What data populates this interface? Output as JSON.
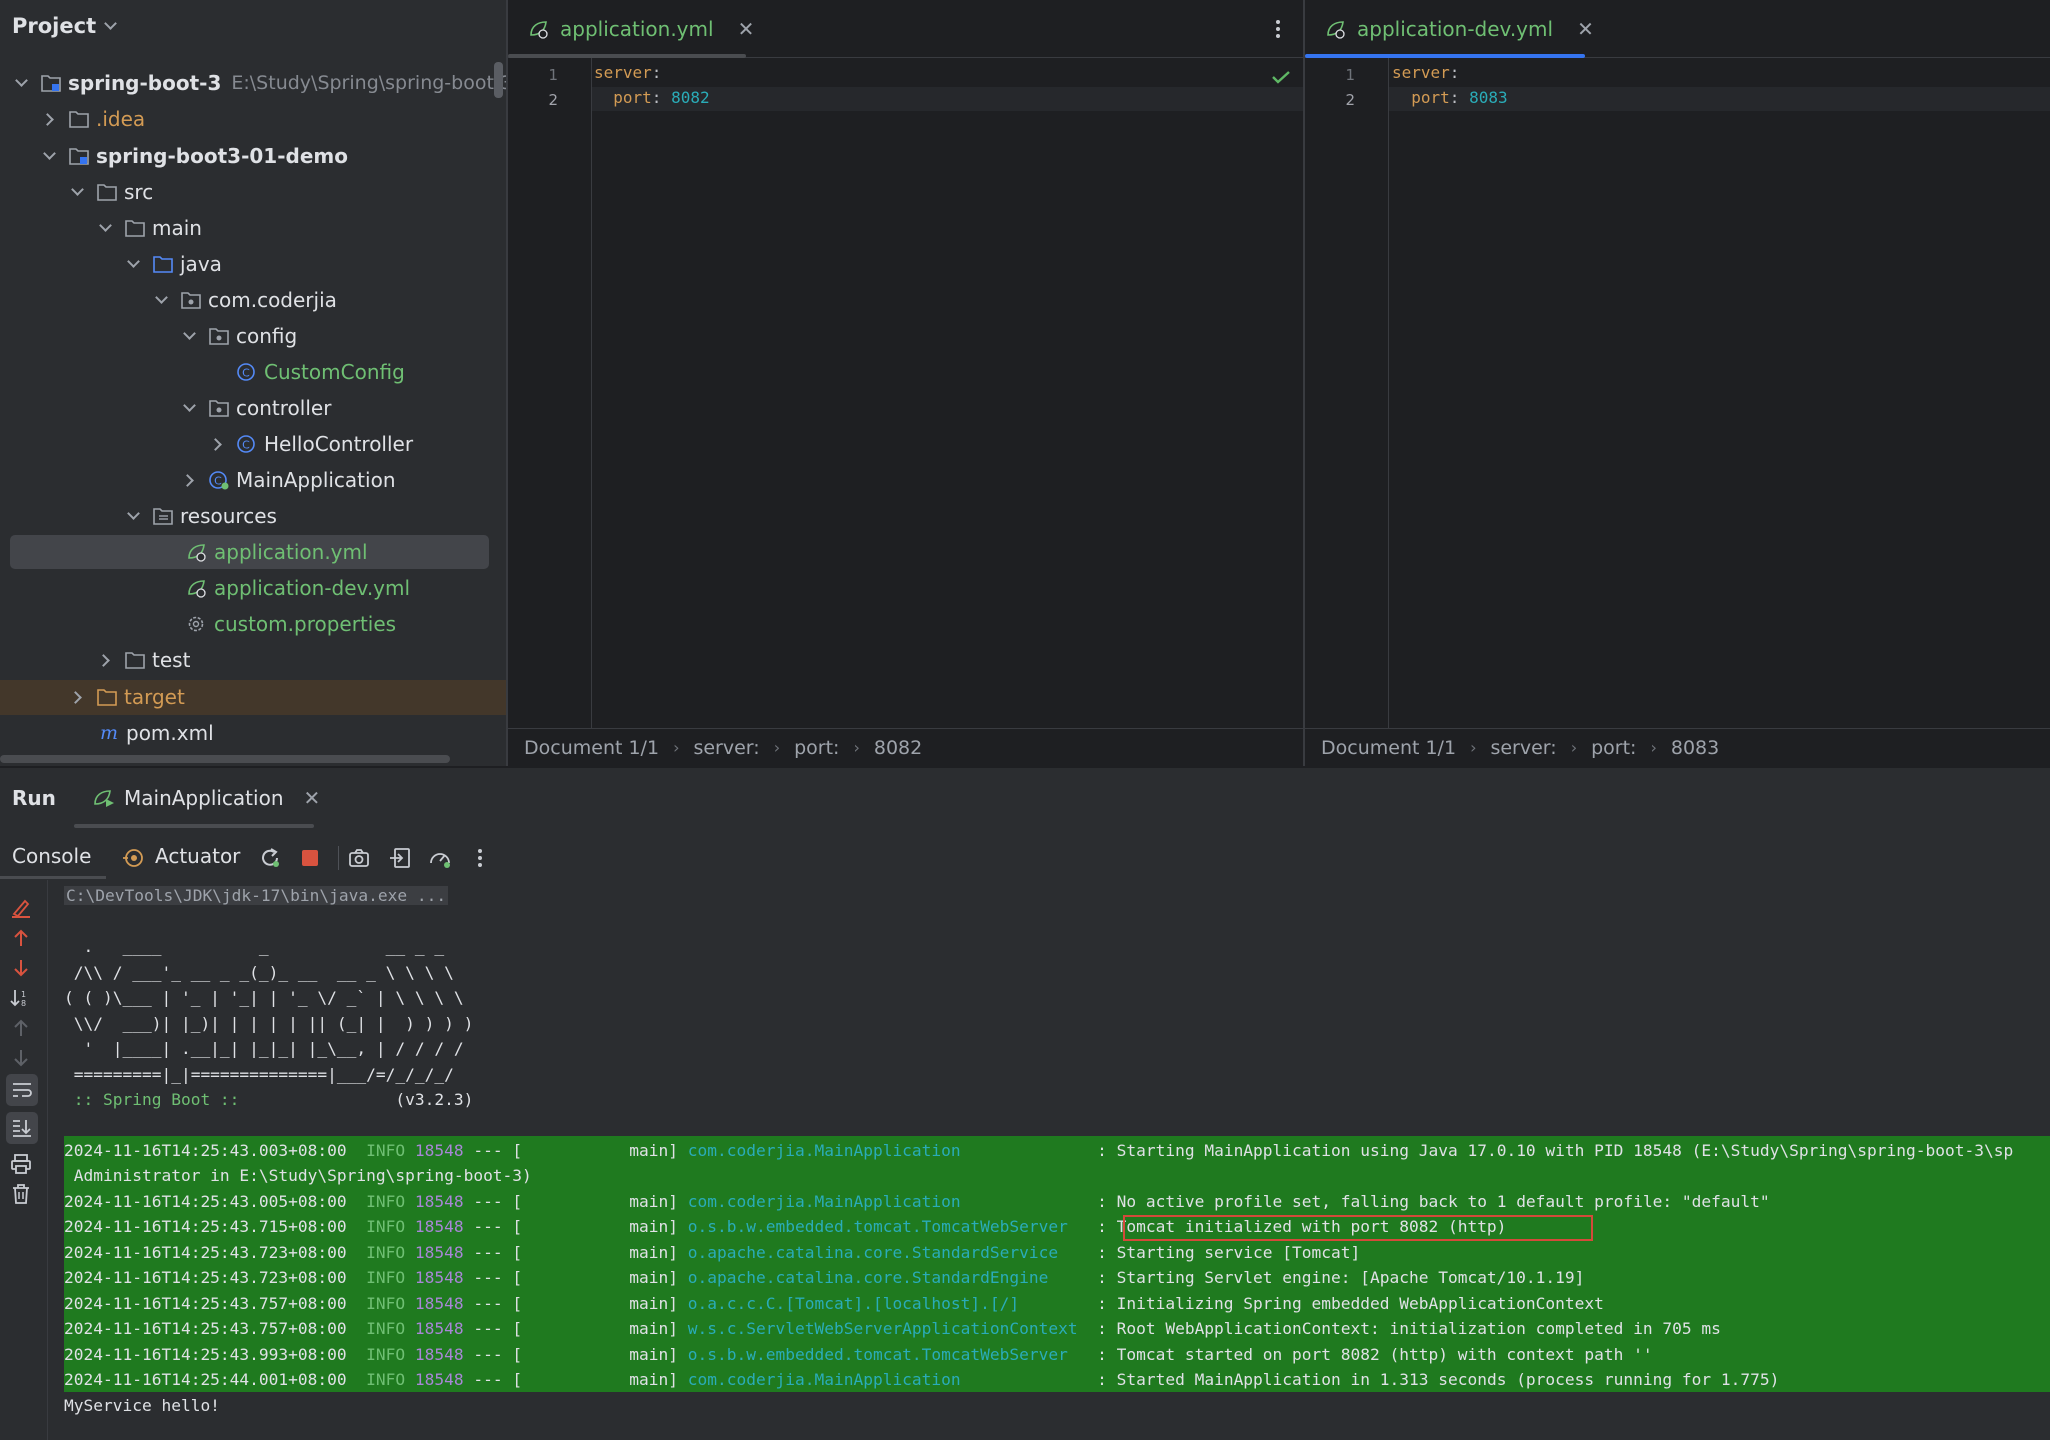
{
  "project": {
    "header": "Project",
    "tree": [
      {
        "label": "spring-boot-3",
        "path": "E:\\Study\\Spring\\spring-boot-3"
      },
      {
        "label": ".idea"
      },
      {
        "label": "spring-boot3-01-demo"
      },
      {
        "label": "src"
      },
      {
        "label": "main"
      },
      {
        "label": "java"
      },
      {
        "label": "com.coderjia"
      },
      {
        "label": "config"
      },
      {
        "label": "CustomConfig"
      },
      {
        "label": "controller"
      },
      {
        "label": "HelloController"
      },
      {
        "label": "MainApplication"
      },
      {
        "label": "resources"
      },
      {
        "label": "application.yml"
      },
      {
        "label": "application-dev.yml"
      },
      {
        "label": "custom.properties"
      },
      {
        "label": "test"
      },
      {
        "label": "target"
      },
      {
        "label": "pom.xml"
      }
    ]
  },
  "editors": [
    {
      "tab": "application.yml",
      "lines": [
        {
          "num": "1",
          "key": "server",
          "punc": ":"
        },
        {
          "num": "2",
          "key": "  port",
          "punc": ": ",
          "value": "8082"
        }
      ],
      "breadcrumb": [
        "Document 1/1",
        "server:",
        "port:",
        "8082"
      ]
    },
    {
      "tab": "application-dev.yml",
      "lines": [
        {
          "num": "1",
          "key": "server",
          "punc": ":"
        },
        {
          "num": "2",
          "key": "  port",
          "punc": ": ",
          "value": "8083"
        }
      ],
      "breadcrumb": [
        "Document 1/1",
        "server:",
        "port:",
        "8083"
      ]
    }
  ],
  "run": {
    "title": "Run",
    "tab": "MainApplication",
    "toolbar": {
      "console": "Console",
      "actuator": "Actuator"
    },
    "command": "C:\\DevTools\\JDK\\jdk-17\\bin\\java.exe ...",
    "banner": [
      "  .   ____          _            __ _ _",
      " /\\\\ / ___'_ __ _ _(_)_ __  __ _ \\ \\ \\ \\",
      "( ( )\\___ | '_ | '_| | '_ \\/ _` | \\ \\ \\ \\",
      " \\\\/  ___)| |_)| | | | | || (_| |  ) ) ) )",
      "  '  |____| .__|_| |_|_| |_\\__, | / / / /",
      " =========|_|==============|___/=/_/_/_/"
    ],
    "spring_tag": " :: Spring Boot ::",
    "spring_version": "(v3.2.3)",
    "logs": [
      {
        "ts": "2024-11-16T14:25:43.003+08:00",
        "level": "INFO",
        "pid": "18548",
        "thread": "--- [           main]",
        "logger": "com.coderjia.MainApplication           ",
        "msg": ": Starting MainApplication using Java 17.0.10 with PID 18548 (E:\\Study\\Spring\\spring-boot-3\\sp"
      },
      {
        "cont": " Administrator in E:\\Study\\Spring\\spring-boot-3)"
      },
      {
        "ts": "2024-11-16T14:25:43.005+08:00",
        "level": "INFO",
        "pid": "18548",
        "thread": "--- [           main]",
        "logger": "com.coderjia.MainApplication           ",
        "msg": ": No active profile set, falling back to 1 default profile: \"default\""
      },
      {
        "ts": "2024-11-16T14:25:43.715+08:00",
        "level": "INFO",
        "pid": "18548",
        "thread": "--- [           main]",
        "logger": "o.s.b.w.embedded.tomcat.TomcatWebServer ",
        "msg": ": Tomcat initialized with port 8082 (http)"
      },
      {
        "ts": "2024-11-16T14:25:43.723+08:00",
        "level": "INFO",
        "pid": "18548",
        "thread": "--- [           main]",
        "logger": "o.apache.catalina.core.StandardService  ",
        "msg": ": Starting service [Tomcat]"
      },
      {
        "ts": "2024-11-16T14:25:43.723+08:00",
        "level": "INFO",
        "pid": "18548",
        "thread": "--- [           main]",
        "logger": "o.apache.catalina.core.StandardEngine   ",
        "msg": ": Starting Servlet engine: [Apache Tomcat/10.1.19]"
      },
      {
        "ts": "2024-11-16T14:25:43.757+08:00",
        "level": "INFO",
        "pid": "18548",
        "thread": "--- [           main]",
        "logger": "o.a.c.c.C.[Tomcat].[localhost].[/]      ",
        "msg": ": Initializing Spring embedded WebApplicationContext"
      },
      {
        "ts": "2024-11-16T14:25:43.757+08:00",
        "level": "INFO",
        "pid": "18548",
        "thread": "--- [           main]",
        "logger": "w.s.c.ServletWebServerApplicationContext ",
        "msg": ": Root WebApplicationContext: initialization completed in 705 ms"
      },
      {
        "ts": "2024-11-16T14:25:43.993+08:00",
        "level": "INFO",
        "pid": "18548",
        "thread": "--- [           main]",
        "logger": "o.s.b.w.embedded.tomcat.TomcatWebServer ",
        "msg": ": Tomcat started on port 8082 (http) with context path ''"
      },
      {
        "ts": "2024-11-16T14:25:44.001+08:00",
        "level": "INFO",
        "pid": "18548",
        "thread": "--- [           main]",
        "logger": "com.coderjia.MainApplication           ",
        "msg": ": Started MainApplication in 1.313 seconds (process running for 1.775)"
      }
    ],
    "output": "MyService hello!"
  },
  "colors": {
    "accent": "#3574f0",
    "green": "#6fbf73",
    "log_bg": "#1f7a1f",
    "highlight_box": "#d44a3a"
  }
}
